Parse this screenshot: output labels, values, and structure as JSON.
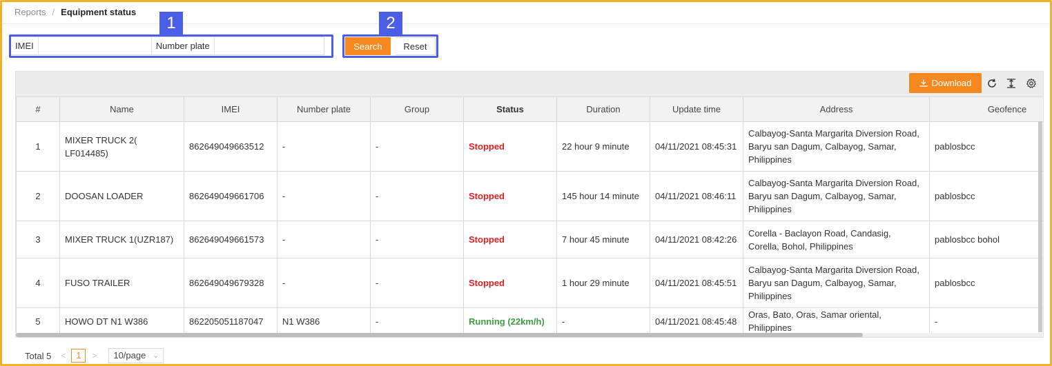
{
  "breadcrumb": {
    "parent": "Reports",
    "separator": "/",
    "current": "Equipment status"
  },
  "callouts": {
    "one": "1",
    "two": "2"
  },
  "filters": {
    "imei_label": "IMEI",
    "imei_value": "",
    "plate_label": "Number plate",
    "plate_value": ""
  },
  "buttons": {
    "search": "Search",
    "reset": "Reset",
    "download": "Download"
  },
  "toolbar_icons": [
    "refresh-icon",
    "column-height-icon",
    "settings-icon"
  ],
  "table": {
    "columns": [
      "#",
      "Name",
      "IMEI",
      "Number plate",
      "Group",
      "Status",
      "Duration",
      "Update time",
      "Address",
      "Geofence"
    ],
    "rows": [
      {
        "num": "1",
        "name": "MIXER TRUCK 2( LF014485)",
        "imei": "862649049663512",
        "plate": "-",
        "group": "-",
        "status": "Stopped",
        "duration": "22 hour 9 minute",
        "update": "04/11/2021 08:45:31",
        "address": "Calbayog-Santa Margarita Diversion Road, Baryu san Dagum, Calbayog, Samar, Philippines",
        "geofence": "pablosbcc"
      },
      {
        "num": "2",
        "name": "DOOSAN LOADER",
        "imei": "862649049661706",
        "plate": "-",
        "group": "-",
        "status": "Stopped",
        "duration": "145 hour 14 minute",
        "update": "04/11/2021 08:46:11",
        "address": "Calbayog-Santa Margarita Diversion Road, Baryu san Dagum, Calbayog, Samar, Philippines",
        "geofence": "pablosbcc"
      },
      {
        "num": "3",
        "name": "MIXER TRUCK 1(UZR187)",
        "imei": "862649049661573",
        "plate": "-",
        "group": "-",
        "status": "Stopped",
        "duration": "7 hour 45 minute",
        "update": "04/11/2021 08:42:26",
        "address": "Corella - Baclayon Road, Candasig, Corella, Bohol, Philippines",
        "geofence": "pablosbcc bohol"
      },
      {
        "num": "4",
        "name": "FUSO TRAILER",
        "imei": "862649049679328",
        "plate": "-",
        "group": "-",
        "status": "Stopped",
        "duration": "1 hour 29 minute",
        "update": "04/11/2021 08:45:51",
        "address": "Calbayog-Santa Margarita Diversion Road, Baryu san Dagum, Calbayog, Samar, Philippines",
        "geofence": "pablosbcc"
      },
      {
        "num": "5",
        "name": "HOWO DT N1 W386",
        "imei": "862205051187047",
        "plate": "N1 W386",
        "group": "-",
        "status": "Running (22km/h)",
        "duration": "-",
        "update": "04/11/2021 08:45:48",
        "address": "Oras, Bato, Oras, Samar oriental, Philippines",
        "geofence": "-"
      }
    ]
  },
  "pagination": {
    "total": "Total 5",
    "prev": "<",
    "current_page": "1",
    "next": ">",
    "page_size": "10/page"
  },
  "colors": {
    "accent": "#f5891f",
    "callout": "#4a5ee8",
    "stopped": "#e02020",
    "running": "#3aa040",
    "frame": "#f0b429"
  }
}
